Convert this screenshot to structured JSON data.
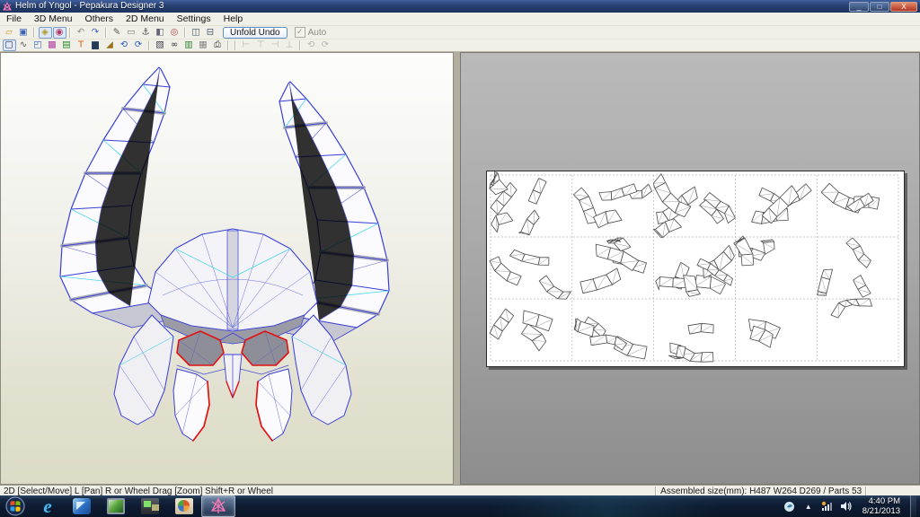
{
  "window": {
    "title": "Helm of Yngol - Pepakura Designer 3",
    "controls": {
      "minimize": "_",
      "maximize": "□",
      "close": "X"
    }
  },
  "menu_bar": {
    "items": [
      "File",
      "3D Menu",
      "Others",
      "2D Menu",
      "Settings",
      "Help"
    ]
  },
  "toolbar_main": {
    "unfold_undo_label": "Unfold Undo",
    "auto_label": "Auto",
    "auto_checked": "✓",
    "icons": [
      {
        "name": "open-file-icon",
        "glyph": "▱",
        "color": "#c9982a"
      },
      {
        "name": "save-icon",
        "glyph": "▣",
        "color": "#3a5fae"
      },
      {
        "sep": true
      },
      {
        "name": "show-edges-icon",
        "glyph": "◈",
        "color": "#b09a20",
        "pressed": true
      },
      {
        "name": "show-materials-icon",
        "glyph": "◉",
        "color": "#b03a6a",
        "pressed": true
      },
      {
        "sep": true
      },
      {
        "name": "undo-icon",
        "glyph": "↶",
        "color": "#8a8a8a"
      },
      {
        "name": "redo-icon",
        "glyph": "↷",
        "color": "#3a66c0"
      },
      {
        "sep": true
      },
      {
        "name": "pen-tool-icon",
        "glyph": "✎",
        "color": "#555555"
      },
      {
        "name": "eraser-tool-icon",
        "glyph": "▭",
        "color": "#777777"
      },
      {
        "name": "anchor-icon",
        "glyph": "⚓",
        "color": "#444444"
      },
      {
        "name": "cube-view-icon",
        "glyph": "◧",
        "color": "#666677"
      },
      {
        "name": "pin-point-icon",
        "glyph": "◎",
        "color": "#b04040"
      },
      {
        "sep": true
      },
      {
        "name": "layout-3d-2d-icon",
        "glyph": "◫",
        "color": "#445566"
      },
      {
        "name": "layout-2d-only-icon",
        "glyph": "⊟",
        "color": "#445566"
      }
    ]
  },
  "toolbar_2d": {
    "icons": [
      {
        "name": "select-move-icon",
        "glyph": "▢",
        "color": "#333355",
        "pressed": true
      },
      {
        "name": "lasso-select-icon",
        "glyph": "∿",
        "color": "#555555"
      },
      {
        "name": "new-window-icon",
        "glyph": "◰",
        "color": "#3a66c0"
      },
      {
        "name": "texture-view-icon",
        "glyph": "▩",
        "color": "#b040a0"
      },
      {
        "name": "export-sheet-icon",
        "glyph": "▤",
        "color": "#2a8a2a"
      },
      {
        "name": "text-tool-icon",
        "glyph": "T",
        "color": "#d06010"
      },
      {
        "name": "page-setup-icon",
        "glyph": "▆",
        "color": "#223a55"
      },
      {
        "name": "fill-color-icon",
        "glyph": "◢",
        "color": "#967117"
      },
      {
        "name": "rotate-ccw-icon",
        "glyph": "⟲",
        "color": "#2a5ac8"
      },
      {
        "name": "rotate-cw-icon",
        "glyph": "⟳",
        "color": "#2a5ac8"
      },
      {
        "sep": true
      },
      {
        "name": "zoom-area-icon",
        "glyph": "▧",
        "color": "#444455"
      },
      {
        "name": "find-part-icon",
        "glyph": "∞",
        "color": "#333333"
      },
      {
        "name": "parts-list-icon",
        "glyph": "▥",
        "color": "#338833"
      },
      {
        "name": "image-overlay-icon",
        "glyph": "▦",
        "color": "#888888"
      },
      {
        "name": "print-icon",
        "glyph": "⎙",
        "color": "#333333"
      },
      {
        "sep": true
      },
      {
        "sep": true
      },
      {
        "name": "align-left-icon",
        "glyph": "⊢",
        "color": "#555555",
        "disabled": true
      },
      {
        "name": "align-top-icon",
        "glyph": "⊤",
        "color": "#555555",
        "disabled": true
      },
      {
        "name": "align-right-icon",
        "glyph": "⊣",
        "color": "#555555",
        "disabled": true
      },
      {
        "name": "align-bottom-icon",
        "glyph": "⊥",
        "color": "#555555",
        "disabled": true
      },
      {
        "sep": true
      },
      {
        "name": "rotate-part-ccw-icon",
        "glyph": "⟲",
        "color": "#555555",
        "disabled": true
      },
      {
        "name": "rotate-part-cw-icon",
        "glyph": "⟳",
        "color": "#555555",
        "disabled": true
      }
    ]
  },
  "right_pane": {
    "sheet": {
      "rows": 3,
      "cols": 5,
      "parts_per_cell": [
        [
          5,
          4,
          5,
          4,
          3
        ],
        [
          3,
          4,
          6,
          3,
          3
        ],
        [
          3,
          4,
          3,
          2,
          1
        ]
      ],
      "total_parts": 53
    }
  },
  "status_bar": {
    "left_text": "2D [Select/Move] L [Pan] R or Wheel Drag [Zoom] Shift+R or Wheel",
    "right_text": "Assembled size(mm): H487 W264 D269 / Parts 53"
  },
  "taskbar": {
    "apps": [
      {
        "name": "internet-explorer",
        "active": false
      },
      {
        "name": "blue-modeler-app",
        "active": false
      },
      {
        "name": "photo-viewer",
        "active": false
      },
      {
        "name": "media-player",
        "active": false
      },
      {
        "name": "paint-app",
        "active": false
      },
      {
        "name": "pepakura-designer",
        "active": true
      }
    ],
    "tray_icons": [
      "tray-app",
      "hidden-icons-chevron",
      "network",
      "volume"
    ],
    "clock": {
      "time": "4:40 PM",
      "date": "8/21/2013"
    }
  },
  "colors": {
    "edge_blue": "#3a3fd6",
    "edge_cyan": "#49d6e8",
    "open_edge_red": "#e21212",
    "face_shade": "#a9a9b4",
    "dark_shade": "#8e8e98",
    "titlebar_blue": "#27406f",
    "taskbar_navy": "#0d1a30"
  }
}
